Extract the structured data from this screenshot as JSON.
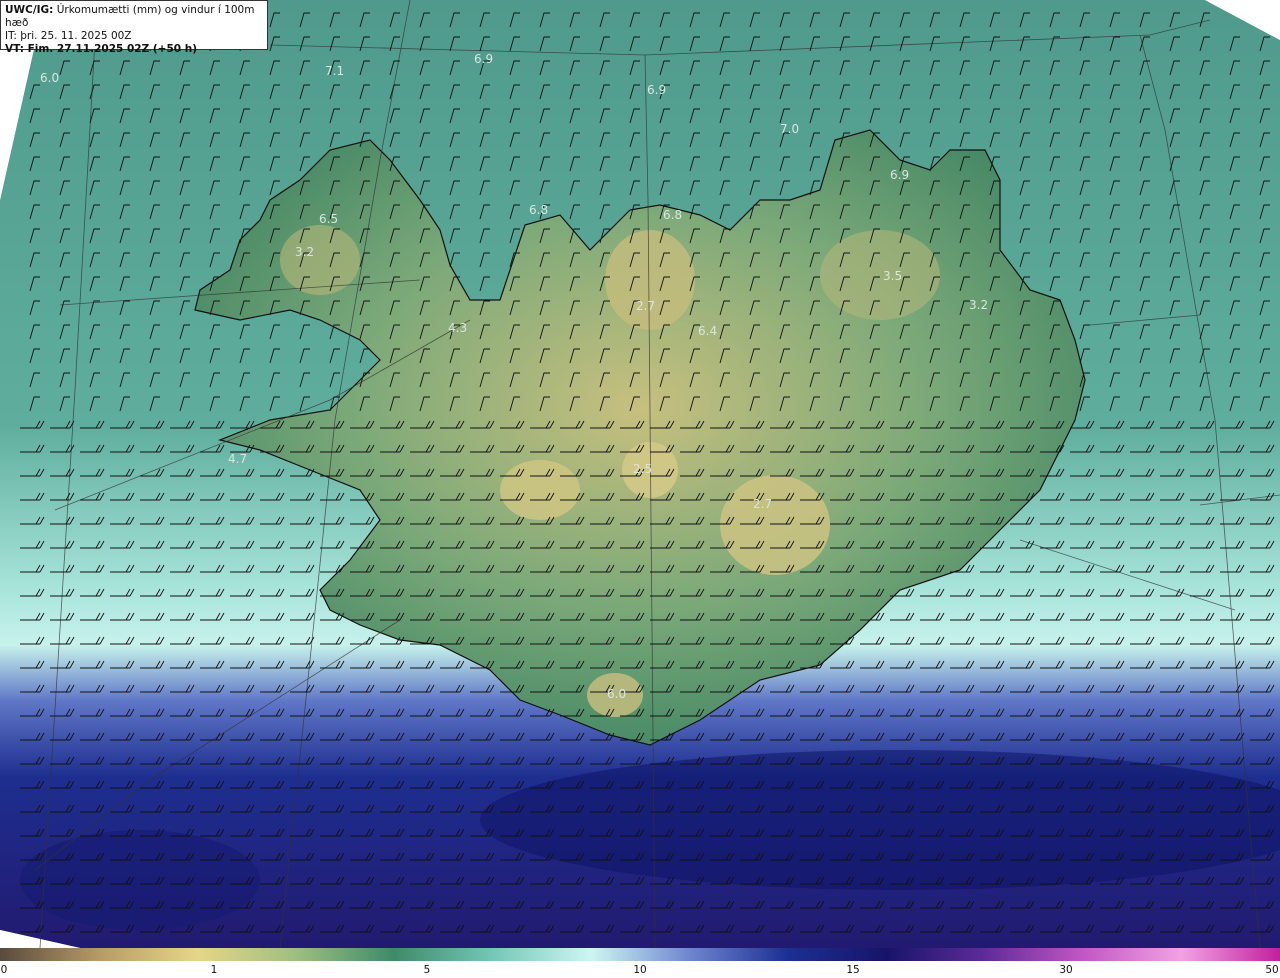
{
  "header": {
    "model_label": "UWC/IG:",
    "title": "Úrkomumætti (mm) og vindur í 100m hæð",
    "it_line": "IT: þri. 25. 11. 2025 00Z",
    "vt_line": "VT: Fim. 27.11.2025 02Z (+50 h)"
  },
  "map": {
    "variable": "precipitable water",
    "units": "mm",
    "wind_barbs": "wind at 100m, barbs",
    "colors": {
      "ocean_north": "#4f9a8c",
      "land_low": "#4f8f6a",
      "land_high": "#c9c27f",
      "ocean_south_light": "#b9ece4",
      "ocean_south_mid": "#4a5fb5",
      "ocean_south_deep": "#1a1a7a",
      "coast": "#111111",
      "grid": "#333333",
      "label_text": "#d8e6e0"
    },
    "value_labels": [
      {
        "text": "6.0"
      },
      {
        "text": "7.1"
      },
      {
        "text": "6.9"
      },
      {
        "text": "6.9"
      },
      {
        "text": "7.0"
      },
      {
        "text": "6.9"
      },
      {
        "text": "6.5"
      },
      {
        "text": "3.2"
      },
      {
        "text": "6.8"
      },
      {
        "text": "6.8"
      },
      {
        "text": "3.5"
      },
      {
        "text": "3.2"
      },
      {
        "text": "2.7"
      },
      {
        "text": "6.4"
      },
      {
        "text": "4.3"
      },
      {
        "text": "4.7"
      },
      {
        "text": "2.5"
      },
      {
        "text": "2.7"
      },
      {
        "text": "6.0"
      }
    ]
  },
  "colorbar": {
    "ticks": [
      "0",
      "1",
      "5",
      "10",
      "15",
      "30",
      "50"
    ],
    "stops": [
      "#5a4a3e",
      "#b69a66",
      "#e6d688",
      "#9fbf7f",
      "#3f8a6a",
      "#74c7b6",
      "#cdf6f2",
      "#6f86cf",
      "#1c2f93",
      "#17146a",
      "#5e2b98",
      "#c257c4",
      "#f2a2e4",
      "#c21f9e"
    ]
  }
}
